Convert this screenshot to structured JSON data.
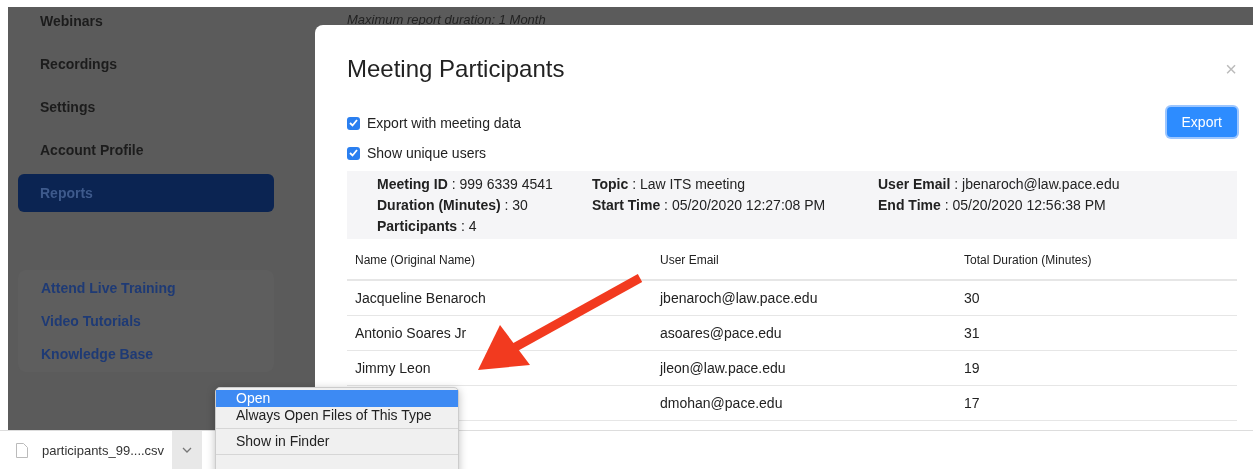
{
  "sidebar": {
    "items": [
      {
        "label": "Webinars",
        "selected": false
      },
      {
        "label": "Recordings",
        "selected": false
      },
      {
        "label": "Settings",
        "selected": false
      },
      {
        "label": "Account Profile",
        "selected": false
      },
      {
        "label": "Reports",
        "selected": true
      }
    ],
    "links": [
      "Attend Live Training",
      "Video Tutorials",
      "Knowledge Base"
    ]
  },
  "page_note": "Maximum report duration: 1 Month",
  "dialog": {
    "title": "Meeting Participants",
    "close": "×",
    "options": [
      {
        "label": "Export with meeting data",
        "checked": true
      },
      {
        "label": "Show unique users",
        "checked": true
      }
    ],
    "export_button": "Export",
    "meeting_info": [
      [
        {
          "key": "Meeting ID",
          "value": ": 999 6339 4541"
        },
        {
          "key": "Duration (Minutes)",
          "value": ": 30"
        },
        {
          "key": "Participants",
          "value": ": 4"
        }
      ],
      [
        {
          "key": "Topic",
          "value": ": Law ITS meeting"
        },
        {
          "key": "Start Time",
          "value": ": 05/20/2020 12:27:08 PM"
        }
      ],
      [
        {
          "key": "User Email",
          "value": ": jbenaroch@law.pace.edu"
        },
        {
          "key": "End Time",
          "value": ": 05/20/2020 12:56:38 PM"
        }
      ]
    ],
    "table": {
      "columns": [
        "Name (Original Name)",
        "User Email",
        "Total Duration (Minutes)"
      ],
      "rows": [
        {
          "name": "Jacqueline Benaroch",
          "email": "jbenaroch@law.pace.edu",
          "duration": "30"
        },
        {
          "name": "Antonio Soares Jr",
          "email": "asoares@pace.edu",
          "duration": "31"
        },
        {
          "name": "Jimmy Leon",
          "email": "jleon@law.pace.edu",
          "duration": "19"
        },
        {
          "email": "dmohan@pace.edu",
          "duration": "17"
        }
      ]
    }
  },
  "download_bar": {
    "file": "participants_99....csv"
  },
  "context_menu": {
    "items": [
      {
        "label": "Open",
        "selected": true,
        "separator_after": false
      },
      {
        "label": "Always Open Files of This Type",
        "selected": false,
        "separator_after": true
      },
      {
        "label": "Show in Finder",
        "selected": false,
        "separator_after": true
      }
    ]
  }
}
